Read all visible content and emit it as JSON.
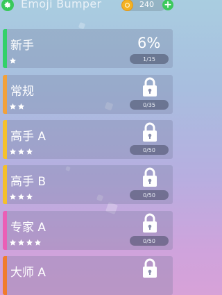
{
  "app": {
    "title": "Emoji Bumper"
  },
  "wallet": {
    "coins": "240",
    "add_label": "+"
  },
  "colors": {
    "green": "#33d16a",
    "orange": "#f2a13a",
    "yellow": "#f5c12b",
    "yellow2": "#f4bf2c",
    "pink": "#ea5fb6",
    "orange2": "#f07c2c"
  },
  "levels": [
    {
      "name": "新手",
      "stars": 1,
      "progress": "1/15",
      "completion": "6%",
      "locked": false
    },
    {
      "name": "常规",
      "stars": 2,
      "progress": "0/35",
      "locked": true
    },
    {
      "name": "高手 A",
      "stars": 3,
      "progress": "0/50",
      "locked": true
    },
    {
      "name": "高手 B",
      "stars": 3,
      "progress": "0/50",
      "locked": true
    },
    {
      "name": "专家 A",
      "stars": 4,
      "progress": "0/50",
      "locked": true
    },
    {
      "name": "大师 A",
      "stars": 0,
      "progress": "",
      "locked": true
    }
  ]
}
